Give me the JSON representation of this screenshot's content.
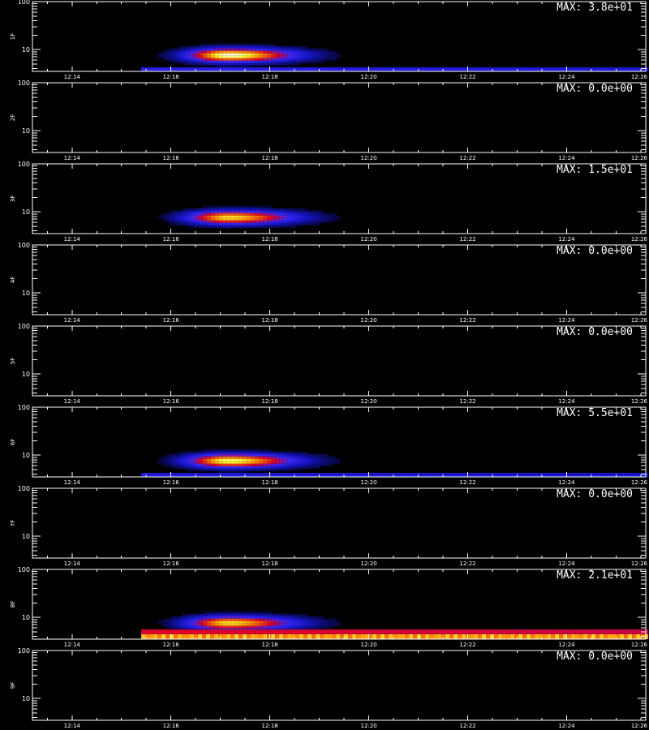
{
  "chart_data": [
    {
      "type": "heatmap",
      "panel": "1F",
      "ylabel": "1F",
      "max_label": "MAX: 3.8e+01",
      "max_value": 38,
      "yscale": "log",
      "yticks": [
        10,
        100
      ],
      "ytick_labels": [
        "10",
        "100"
      ],
      "xtick_labels": [
        "12:14",
        "12:16",
        "12:18",
        "12:20",
        "12:22",
        "12:24",
        "12:26"
      ],
      "blobs": [
        {
          "time": "12:17",
          "y_center": 8,
          "intensity": 1.0,
          "width_min": 1.5
        }
      ],
      "bottom_band": {
        "start": "12:15.4",
        "intensity": 0.3,
        "color": "blue"
      }
    },
    {
      "type": "heatmap",
      "panel": "2F",
      "ylabel": "2F",
      "max_label": "MAX: 0.0e+00",
      "max_value": 0,
      "yscale": "log",
      "yticks": [
        10,
        100
      ],
      "ytick_labels": [
        "10",
        "100"
      ],
      "xtick_labels": [
        "12:14",
        "12:16",
        "12:18",
        "12:20",
        "12:22",
        "12:24",
        "12:26"
      ],
      "blobs": []
    },
    {
      "type": "heatmap",
      "panel": "3F",
      "ylabel": "3F",
      "max_label": "MAX: 1.5e+01",
      "max_value": 15,
      "yscale": "log",
      "yticks": [
        10,
        100
      ],
      "ytick_labels": [
        "10",
        "100"
      ],
      "xtick_labels": [
        "12:14",
        "12:16",
        "12:18",
        "12:20",
        "12:22",
        "12:24",
        "12:26"
      ],
      "blobs": [
        {
          "time": "12:17",
          "y_center": 8,
          "intensity": 0.9,
          "width_min": 1.5
        }
      ]
    },
    {
      "type": "heatmap",
      "panel": "4F",
      "ylabel": "4F",
      "max_label": "MAX: 0.0e+00",
      "max_value": 0,
      "yscale": "log",
      "yticks": [
        10,
        100
      ],
      "ytick_labels": [
        "10",
        "100"
      ],
      "xtick_labels": [
        "12:14",
        "12:16",
        "12:18",
        "12:20",
        "12:22",
        "12:24",
        "12:26"
      ],
      "blobs": []
    },
    {
      "type": "heatmap",
      "panel": "5F",
      "ylabel": "5F",
      "max_label": "MAX: 0.0e+00",
      "max_value": 0,
      "yscale": "log",
      "yticks": [
        10,
        100
      ],
      "ytick_labels": [
        "10",
        "100"
      ],
      "xtick_labels": [
        "12:14",
        "12:16",
        "12:18",
        "12:20",
        "12:22",
        "12:24",
        "12:26"
      ],
      "blobs": []
    },
    {
      "type": "heatmap",
      "panel": "6F",
      "ylabel": "6F",
      "max_label": "MAX: 5.5e+01",
      "max_value": 55,
      "yscale": "log",
      "yticks": [
        10,
        100
      ],
      "ytick_labels": [
        "10",
        "100"
      ],
      "xtick_labels": [
        "12:14",
        "12:16",
        "12:18",
        "12:20",
        "12:22",
        "12:24",
        "12:26"
      ],
      "blobs": [
        {
          "time": "12:17",
          "y_center": 8,
          "intensity": 0.95,
          "width_min": 1.5
        }
      ],
      "bottom_band": {
        "start": "12:15.4",
        "intensity": 0.25,
        "color": "blue"
      }
    },
    {
      "type": "heatmap",
      "panel": "7F",
      "ylabel": "7F",
      "max_label": "MAX: 0.0e+00",
      "max_value": 0,
      "yscale": "log",
      "yticks": [
        10,
        100
      ],
      "ytick_labels": [
        "10",
        "100"
      ],
      "xtick_labels": [
        "12:14",
        "12:16",
        "12:18",
        "12:20",
        "12:22",
        "12:24",
        "12:26"
      ],
      "blobs": []
    },
    {
      "type": "heatmap",
      "panel": "8F",
      "ylabel": "8F",
      "max_label": "MAX: 2.1e+01",
      "max_value": 21,
      "yscale": "log",
      "yticks": [
        10,
        100
      ],
      "ytick_labels": [
        "10",
        "100"
      ],
      "xtick_labels": [
        "12:14",
        "12:16",
        "12:18",
        "12:20",
        "12:22",
        "12:24",
        "12:26"
      ],
      "blobs": [
        {
          "time": "12:17",
          "y_center": 8,
          "intensity": 0.9,
          "width_min": 1.5
        }
      ],
      "bottom_band": {
        "start": "12:15.4",
        "intensity": 0.85,
        "color": "yellow"
      }
    },
    {
      "type": "heatmap",
      "panel": "9F",
      "ylabel": "9F",
      "max_label": "MAX: 0.0e+00",
      "max_value": 0,
      "yscale": "log",
      "yticks": [
        10,
        100
      ],
      "ytick_labels": [
        "10",
        "100"
      ],
      "xtick_labels": [
        "12:14",
        "12:16",
        "12:18",
        "12:20",
        "12:22",
        "12:24",
        "12:26"
      ],
      "blobs": []
    }
  ],
  "colors": {
    "background": "#000000",
    "axis": "#ffffff"
  }
}
